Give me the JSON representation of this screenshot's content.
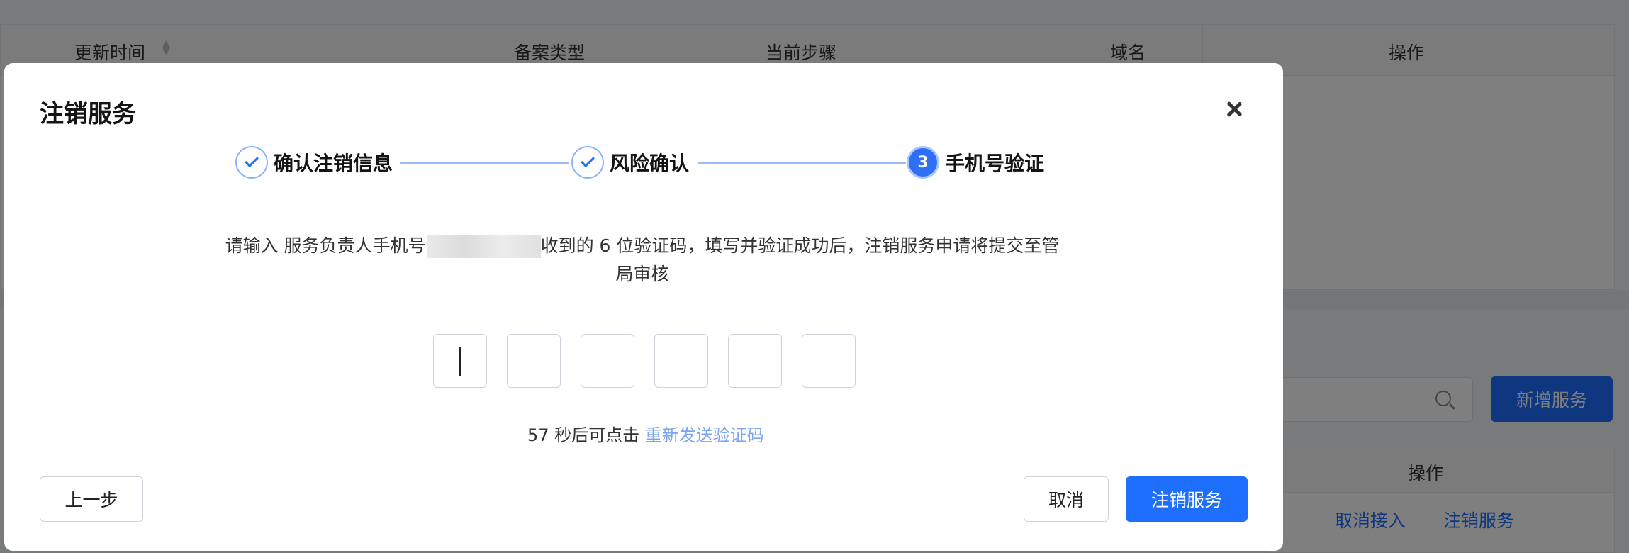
{
  "background": {
    "table_headers": [
      "更新时间",
      "备案类型",
      "当前步骤",
      "域名",
      "操作"
    ],
    "add_button_label": "新增服务",
    "table2_header": "操作",
    "row_actions": [
      "取消接入",
      "注销服务"
    ]
  },
  "dialog": {
    "title": "注销服务",
    "steps": [
      {
        "label": "确认注销信息",
        "state": "done"
      },
      {
        "label": "风险确认",
        "state": "done"
      },
      {
        "number": "3",
        "label": "手机号验证",
        "state": "active"
      }
    ],
    "description_prefix": "请输入 服务负责人手机号",
    "description_suffix": "收到的 6 位验证码，填写并验证成功后，注销服务申请将提交至管局审核",
    "resend_prefix": "57 秒后可点击 ",
    "resend_link": "重新发送验证码",
    "prev_button": "上一步",
    "cancel_button": "取消",
    "confirm_button": "注销服务"
  },
  "colors": {
    "primary": "#1f6fff",
    "link": "#7aa3f0",
    "step_line": "#9bbcf7"
  }
}
